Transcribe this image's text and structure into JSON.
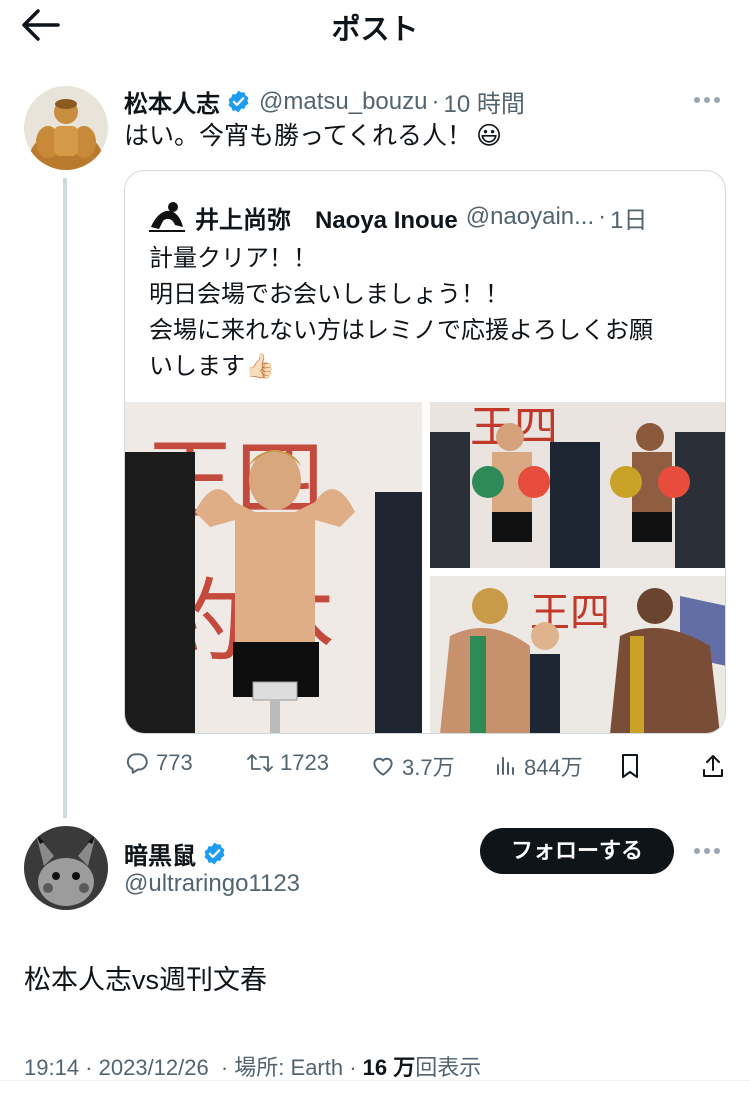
{
  "header": {
    "title": "ポスト"
  },
  "parent_post": {
    "author_name": "松本人志",
    "handle": "@matsu_bouzu",
    "separator": "·",
    "time": "10 時間",
    "text": "はい。今宵も勝ってくれる人！",
    "emoji": "😃"
  },
  "quoted_post": {
    "author_name": "井上尚弥　Naoya Inoue",
    "handle": "@naoyain...",
    "separator": "·",
    "time": "1日",
    "lines": [
      "計量クリア！！",
      "明日会場でお会いしましょう！！",
      "会場に来れない方はレミノで応援よろしくお願",
      "いします👍🏻"
    ]
  },
  "actions": {
    "replies": "773",
    "reposts": "1723",
    "likes": "3.7万",
    "views": "844万"
  },
  "main_post": {
    "author_name": "暗黒鼠",
    "handle": "@ultraringo1123",
    "follow_label": "フォローする",
    "text": "松本人志vs週刊文春",
    "time": "19:14",
    "date": "2023/12/26",
    "location": "場所: Earth",
    "views_count": "16 万",
    "views_label": "回表示",
    "separator": " · "
  },
  "colors": {
    "verified": "#1d9bf0",
    "text": "#0f1419",
    "muted": "#536471",
    "border": "#cfd9de",
    "poster_red": "#c0392b"
  },
  "icons": [
    "back-arrow-icon",
    "verified-badge-icon",
    "more-icon",
    "reply-icon",
    "repost-icon",
    "like-icon",
    "views-icon",
    "bookmark-icon",
    "share-icon"
  ]
}
